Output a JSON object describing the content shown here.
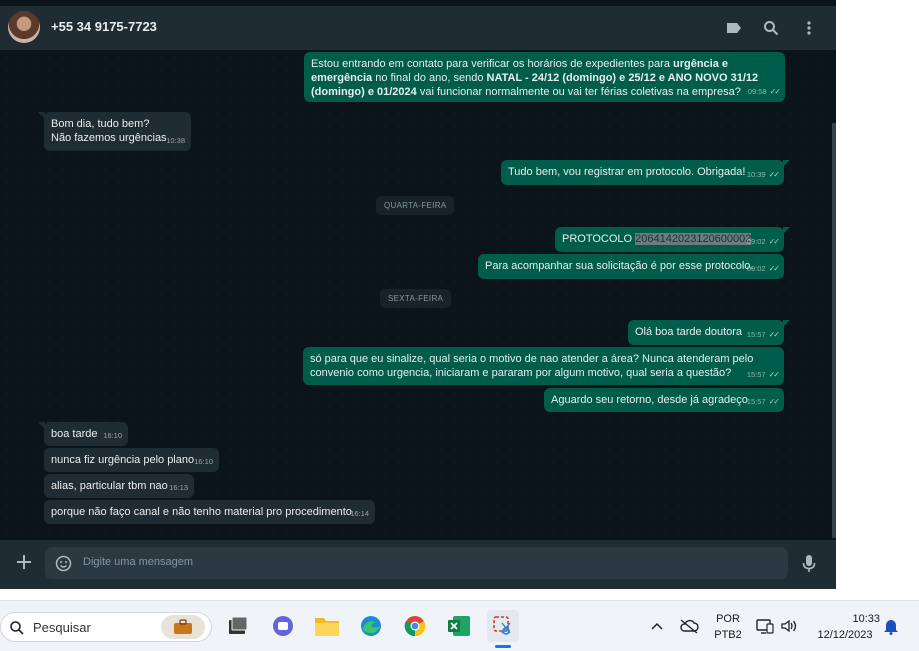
{
  "header": {
    "contact": "+55 34 9175-7723"
  },
  "messages": [
    {
      "dir": "out",
      "parts": [
        "Estou entrando em contato para verificar os horários de expedientes para ",
        "urgência e emergência",
        " no final do ano, sendo ",
        "NATAL - 24/12 (domingo) e  25/12 e ANO NOVO 31/12 (domingo) e 01/2024",
        " vai funcionar normalmente ou vai ter férias coletivas na empresa?"
      ],
      "time": "09:58"
    },
    {
      "dir": "in",
      "lines": [
        "Bom dia, tudo bem?",
        "Não fazemos urgências"
      ],
      "time": "10:38"
    },
    {
      "dir": "out",
      "text": "Tudo bem, vou registrar em protocolo. Obrigada!",
      "time": "10:39"
    },
    {
      "dir": "out",
      "label": "PROTOCOLO",
      "number": "2064142023120600002",
      "time": "09:02"
    },
    {
      "dir": "out",
      "text": "Para acompanhar sua solicitação é por esse protocolo.",
      "time": "09:02"
    },
    {
      "dir": "out",
      "text": "Olá boa tarde doutora",
      "time": "15:57"
    },
    {
      "dir": "out",
      "text": "só para que eu sinalize, qual seria o motivo de nao atender a área? Nunca atenderam pelo convenio como urgencia, iniciaram e pararam por algum motivo, qual seria a questão?",
      "time": "15:57"
    },
    {
      "dir": "out",
      "text": "Aguardo seu retorno, desde já agradeço",
      "time": "15:57"
    },
    {
      "dir": "in",
      "text": "boa tarde",
      "time": "16:10"
    },
    {
      "dir": "in",
      "text": "nunca fiz urgência pelo plano",
      "time": "16:10"
    },
    {
      "dir": "in",
      "text": "alias, particular tbm nao",
      "time": "16:13"
    },
    {
      "dir": "in",
      "text": "porque não faço canal e não tenho material pro procedimento",
      "time": "16:14"
    }
  ],
  "day_dividers": [
    "QUARTA-FEIRA",
    "SEXTA-FEIRA"
  ],
  "composer": {
    "placeholder": "Digite uma mensagem"
  },
  "taskbar": {
    "search_label": "Pesquisar",
    "language": "POR",
    "keyboard": "PTB2",
    "time": "10:33",
    "date": "12/12/2023"
  },
  "colors": {
    "outgoing": "#005c4b",
    "incoming": "#202c33",
    "background": "#0b141a",
    "header": "#202c33"
  },
  "icons": [
    "avatar",
    "label-icon",
    "search-icon",
    "menu-icon",
    "plus-icon",
    "emoji-icon",
    "mic-icon",
    "double-check-icon"
  ]
}
